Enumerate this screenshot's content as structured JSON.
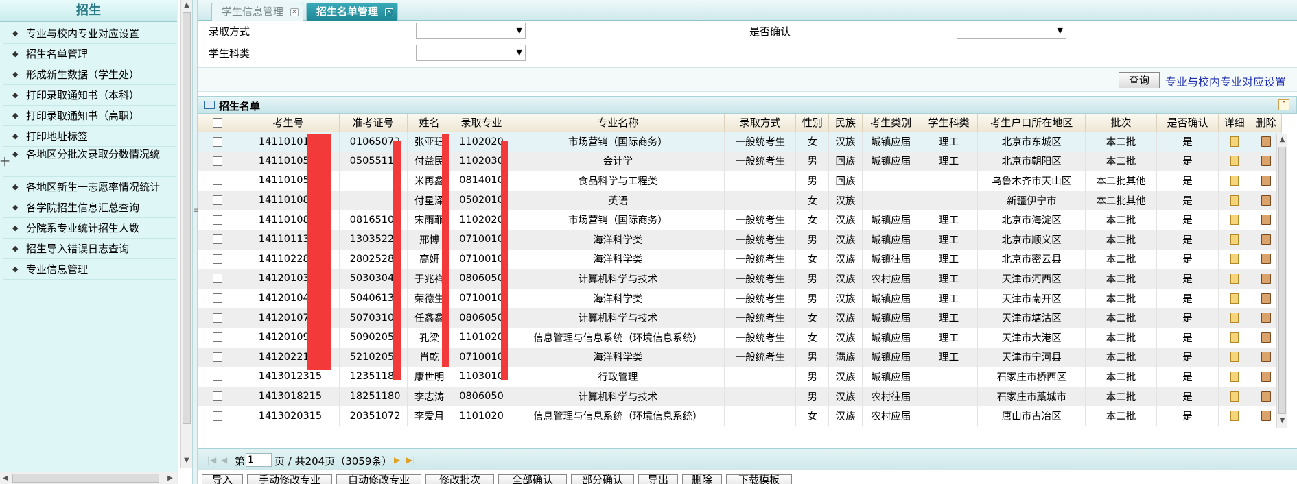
{
  "sidebar": {
    "title": "招生",
    "side_strip": "十",
    "items": [
      {
        "label": "专业与校内专业对应设置"
      },
      {
        "label": "招生名单管理"
      },
      {
        "label": "形成新生数据（学生处）"
      },
      {
        "label": "打印录取通知书（本科）"
      },
      {
        "label": "打印录取通知书（高职）"
      },
      {
        "label": "打印地址标签"
      },
      {
        "label": "各地区分批次录取分数情况统"
      },
      {
        "label": "各地区新生一志愿率情况统计"
      },
      {
        "label": "各学院招生信息汇总查询"
      },
      {
        "label": "分院系专业统计招生人数"
      },
      {
        "label": "招生导入错误日志查询"
      },
      {
        "label": "专业信息管理"
      }
    ]
  },
  "tabs": [
    {
      "label": "学生信息管理",
      "active": false
    },
    {
      "label": "招生名单管理",
      "active": true
    }
  ],
  "form": {
    "admission_method_label": "录取方式",
    "admission_method_value": "",
    "confirmed_label": "是否确认",
    "confirmed_value": "",
    "subject_label": "学生科类",
    "subject_value": ""
  },
  "actions": {
    "query_label": "查询",
    "mapping_link": "专业与校内专业对应设置"
  },
  "grid": {
    "title": "招生名单",
    "columns": [
      "考生号",
      "准考证号",
      "姓名",
      "录取专业",
      "专业名称",
      "录取方式",
      "性别",
      "民族",
      "考生类别",
      "学生科类",
      "考生户口所在地区",
      "批次",
      "是否确认",
      "详细",
      "删除"
    ],
    "rows": [
      {
        "exam_no": "1411010115",
        "ticket": "01065072",
        "name": "张亚珏",
        "major_code": "1102020",
        "major": "市场营销（国际商务）",
        "method": "一般统考生",
        "gender": "女",
        "ethnic": "汉族",
        "category": "城镇应届",
        "subject": "理工",
        "region": "北京市东城区",
        "batch": "本二批",
        "confirmed": "是"
      },
      {
        "exam_no": "1411010515",
        "ticket": "05055110",
        "name": "付益民",
        "major_code": "1102030",
        "major": "会计学",
        "method": "一般统考生",
        "gender": "男",
        "ethnic": "回族",
        "category": "城镇应届",
        "subject": "理工",
        "region": "北京市朝阳区",
        "batch": "本二批",
        "confirmed": "是"
      },
      {
        "exam_no": "1411010515",
        "ticket": "",
        "name": "米再鑫",
        "major_code": "0814010",
        "major": "食品科学与工程类",
        "method": "",
        "gender": "男",
        "ethnic": "回族",
        "category": "",
        "subject": "",
        "region": "乌鲁木齐市天山区",
        "batch": "本二批其他",
        "confirmed": "是"
      },
      {
        "exam_no": "1411010815",
        "ticket": "",
        "name": "付星泽",
        "major_code": "0502010",
        "major": "英语",
        "method": "",
        "gender": "女",
        "ethnic": "汉族",
        "category": "",
        "subject": "",
        "region": "新疆伊宁市",
        "batch": "本二批其他",
        "confirmed": "是"
      },
      {
        "exam_no": "1411010815",
        "ticket": "08165101",
        "name": "宋雨菲",
        "major_code": "1102020",
        "major": "市场营销（国际商务）",
        "method": "一般统考生",
        "gender": "女",
        "ethnic": "汉族",
        "category": "城镇应届",
        "subject": "理工",
        "region": "北京市海淀区",
        "batch": "本二批",
        "confirmed": "是"
      },
      {
        "exam_no": "1411011315",
        "ticket": "13035222",
        "name": "邢博",
        "major_code": "0710010",
        "major": "海洋科学类",
        "method": "一般统考生",
        "gender": "男",
        "ethnic": "汉族",
        "category": "城镇应届",
        "subject": "理工",
        "region": "北京市顺义区",
        "batch": "本二批",
        "confirmed": "是"
      },
      {
        "exam_no": "1411022815",
        "ticket": "28025280",
        "name": "高妍",
        "major_code": "0710010",
        "major": "海洋科学类",
        "method": "一般统考生",
        "gender": "女",
        "ethnic": "汉族",
        "category": "城镇往届",
        "subject": "理工",
        "region": "北京市密云县",
        "batch": "本二批",
        "confirmed": "是"
      },
      {
        "exam_no": "1412010395",
        "ticket": "50303046",
        "name": "于兆祥",
        "major_code": "0806050",
        "major": "计算机科学与技术",
        "method": "一般统考生",
        "gender": "男",
        "ethnic": "汉族",
        "category": "农村应届",
        "subject": "理工",
        "region": "天津市河西区",
        "batch": "本二批",
        "confirmed": "是"
      },
      {
        "exam_no": "1412010495",
        "ticket": "50406139",
        "name": "荣德生",
        "major_code": "0710010",
        "major": "海洋科学类",
        "method": "一般统考生",
        "gender": "男",
        "ethnic": "汉族",
        "category": "城镇应届",
        "subject": "理工",
        "region": "天津市南开区",
        "batch": "本二批",
        "confirmed": "是"
      },
      {
        "exam_no": "1412010797",
        "ticket": "50703104",
        "name": "任鑫鑫",
        "major_code": "0806050",
        "major": "计算机科学与技术",
        "method": "一般统考生",
        "gender": "女",
        "ethnic": "汉族",
        "category": "城镇应届",
        "subject": "理工",
        "region": "天津市塘沽区",
        "batch": "本二批",
        "confirmed": "是"
      },
      {
        "exam_no": "1412010995",
        "ticket": "50902054",
        "name": "孔梁",
        "major_code": "1101020",
        "major": "信息管理与信息系统（环境信息系统）",
        "method": "一般统考生",
        "gender": "女",
        "ethnic": "汉族",
        "category": "城镇应届",
        "subject": "理工",
        "region": "天津市大港区",
        "batch": "本二批",
        "confirmed": "是"
      },
      {
        "exam_no": "1412022195",
        "ticket": "52102059",
        "name": "肖乾",
        "major_code": "0710010",
        "major": "海洋科学类",
        "method": "一般统考生",
        "gender": "男",
        "ethnic": "满族",
        "category": "城镇应届",
        "subject": "理工",
        "region": "天津市宁河县",
        "batch": "本二批",
        "confirmed": "是"
      },
      {
        "exam_no": "1413012315",
        "ticket": "12351182",
        "name": "康世明",
        "major_code": "1103010",
        "major": "行政管理",
        "method": "",
        "gender": "男",
        "ethnic": "汉族",
        "category": "城镇应届",
        "subject": "",
        "region": "石家庄市桥西区",
        "batch": "本二批",
        "confirmed": "是"
      },
      {
        "exam_no": "1413018215",
        "ticket": "18251180",
        "name": "李志涛",
        "major_code": "0806050",
        "major": "计算机科学与技术",
        "method": "",
        "gender": "男",
        "ethnic": "汉族",
        "category": "农村往届",
        "subject": "",
        "region": "石家庄市藁城市",
        "batch": "本二批",
        "confirmed": "是"
      },
      {
        "exam_no": "1413020315",
        "ticket": "20351072",
        "name": "李爱月",
        "major_code": "1101020",
        "major": "信息管理与信息系统（环境信息系统）",
        "method": "",
        "gender": "女",
        "ethnic": "汉族",
        "category": "农村应届",
        "subject": "",
        "region": "唐山市古冶区",
        "batch": "本二批",
        "confirmed": "是"
      }
    ]
  },
  "pager": {
    "page_prefix": "第",
    "current_page": "1",
    "page_suffix": "页 / 共204页（3059条）"
  },
  "bottom_buttons": [
    "导入",
    "手动修改专业",
    "自动修改专业",
    "修改批次",
    "全部确认",
    "部分确认",
    "导出",
    "删除",
    "下载模板"
  ],
  "colors": {
    "accent": "#1f8796",
    "sidebar_bg": "#dff6f7",
    "redaction": "#f33a3a",
    "link": "#2030b0"
  }
}
